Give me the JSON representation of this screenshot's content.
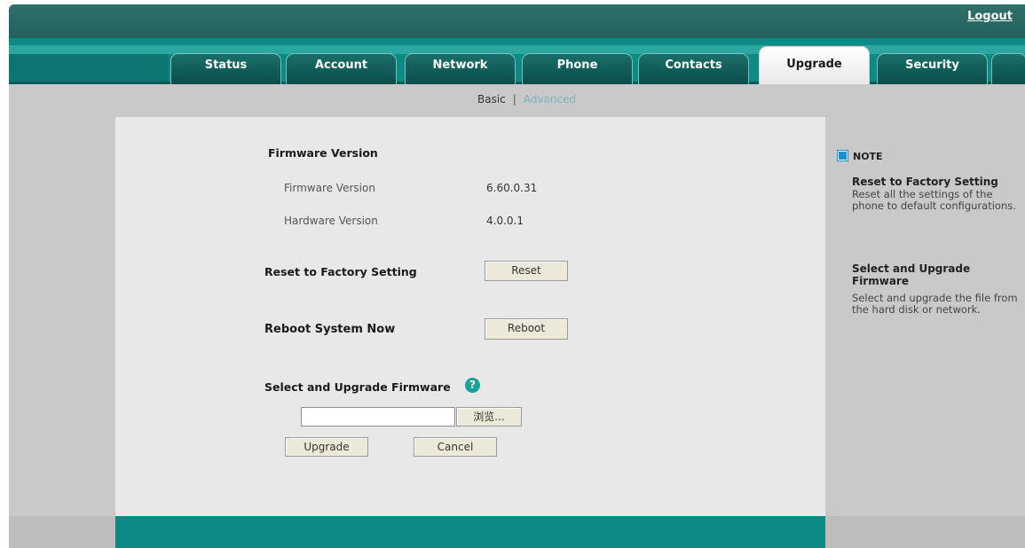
{
  "header": {
    "logout_label": "Logout"
  },
  "tabs": [
    {
      "label": "Status"
    },
    {
      "label": "Account"
    },
    {
      "label": "Network"
    },
    {
      "label": "Phone"
    },
    {
      "label": "Contacts"
    },
    {
      "label": "Upgrade",
      "active": true
    },
    {
      "label": "Security"
    }
  ],
  "subnav": {
    "basic": "Basic",
    "separator": "|",
    "advanced": "Advanced"
  },
  "firmware": {
    "section_title": "Firmware Version",
    "firmware_label": "Firmware Version",
    "firmware_value": "6.60.0.31",
    "hardware_label": "Hardware Version",
    "hardware_value": "4.0.0.1"
  },
  "reset": {
    "title": "Reset to Factory Setting",
    "button": "Reset"
  },
  "reboot": {
    "title": "Reboot System Now",
    "button": "Reboot"
  },
  "upgrade": {
    "title": "Select and Upgrade Firmware",
    "help_icon": "?",
    "browse_button": "浏览...",
    "file_value": "",
    "upgrade_button": "Upgrade",
    "cancel_button": "Cancel"
  },
  "note": {
    "heading": "NOTE",
    "items": [
      {
        "title": "Reset to Factory Setting",
        "text": "Reset all the settings of the phone to default configurations."
      },
      {
        "title": "Select and Upgrade Firmware",
        "text": "Select and upgrade the file from the hard disk or network."
      }
    ]
  },
  "colors": {
    "teal": "#0b8a86",
    "dark_teal": "#23615c",
    "gray": "#c9c9c9",
    "panel": "#e8e8e8"
  }
}
